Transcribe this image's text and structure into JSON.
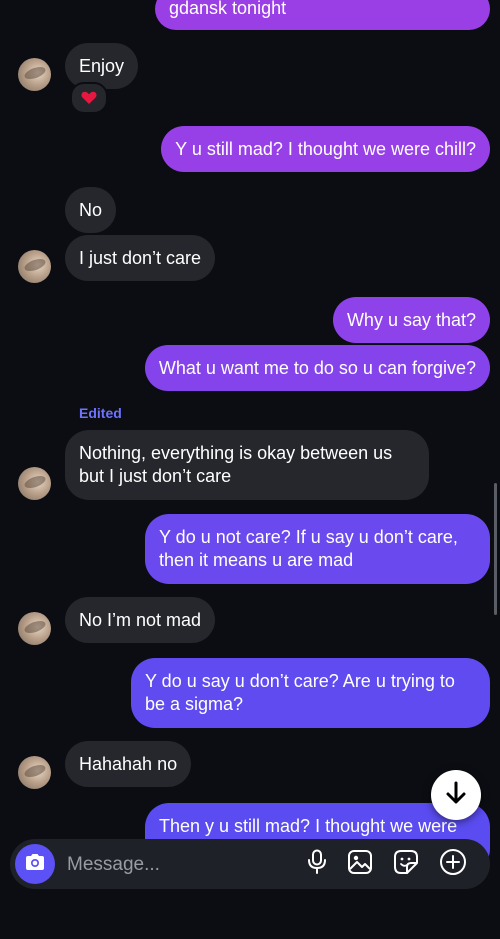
{
  "theme": {
    "background": "#0b0d12",
    "incoming_bubble": "#25272c",
    "outgoing_gradient_top": "#9a3ee6",
    "outgoing_gradient_bottom": "#5a4cf0",
    "accent": "#5b51f5",
    "edited_color": "#6d73ff"
  },
  "messages": [
    {
      "sender": "me",
      "text": "gdansk tonight"
    },
    {
      "sender": "them",
      "text": "Enjoy",
      "reaction": "heart-icon"
    },
    {
      "sender": "me",
      "text": "Y u still mad? I thought we were chill?"
    },
    {
      "sender": "them",
      "text": "No"
    },
    {
      "sender": "them",
      "text": "I just don’t care"
    },
    {
      "sender": "me",
      "text": "Why u say that?"
    },
    {
      "sender": "me",
      "text": "What u want me to do so u can forgive?"
    },
    {
      "sender": "them",
      "text": "Nothing, everything is okay between us but I just don’t care",
      "edited_label": "Edited"
    },
    {
      "sender": "me",
      "text": "Y do u not care? If u say u don’t care, then it means u are mad"
    },
    {
      "sender": "them",
      "text": "No I’m not mad"
    },
    {
      "sender": "me",
      "text": "Y do u say u don’t care? Are u trying to be a sigma?"
    },
    {
      "sender": "them",
      "text": "Hahahah no"
    },
    {
      "sender": "me",
      "text": "Then y u still mad? I thought we were"
    }
  ],
  "composer": {
    "placeholder": "Message...",
    "icons": [
      "camera-icon",
      "microphone-icon",
      "gallery-icon",
      "sticker-icon",
      "add-icon"
    ]
  },
  "jump_to_latest_icon": "arrow-down-icon"
}
